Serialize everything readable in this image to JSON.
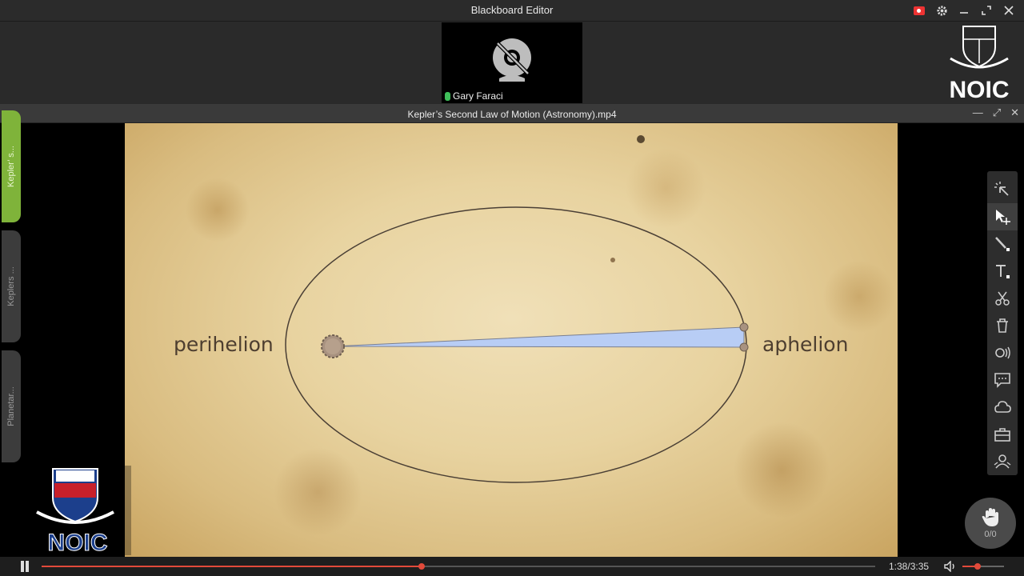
{
  "app": {
    "title": "Blackboard Editor"
  },
  "participant": {
    "name": "Gary Faraci"
  },
  "brand": {
    "name": "NOIC"
  },
  "video": {
    "title": "Kepler’s Second Law of Motion (Astronomy).mp4",
    "labels": {
      "perihelion": "perihelion",
      "aphelion": "aphelion"
    }
  },
  "side_tabs": [
    {
      "label": "Kepler’ s...",
      "active": true
    },
    {
      "label": "Keplers ...",
      "active": false
    },
    {
      "label": "Planetar...",
      "active": false
    }
  ],
  "toolbar": {
    "tools": [
      "laser-pointer-icon",
      "select-move-icon",
      "pen-icon",
      "text-icon",
      "scissors-icon",
      "trash-icon",
      "broadcast-icon",
      "chat-icon",
      "cloud-icon",
      "toolbox-icon",
      "participants-icon"
    ],
    "active": "select-move-icon"
  },
  "hand_raise": {
    "count": "0/0"
  },
  "playback": {
    "time": "1:38/3:35",
    "progress": 0.456,
    "volume": 0.37
  },
  "colors": {
    "accent": "#e24a3a",
    "active_tab": "#7fb33a",
    "sweep": "#b8cdf5"
  }
}
